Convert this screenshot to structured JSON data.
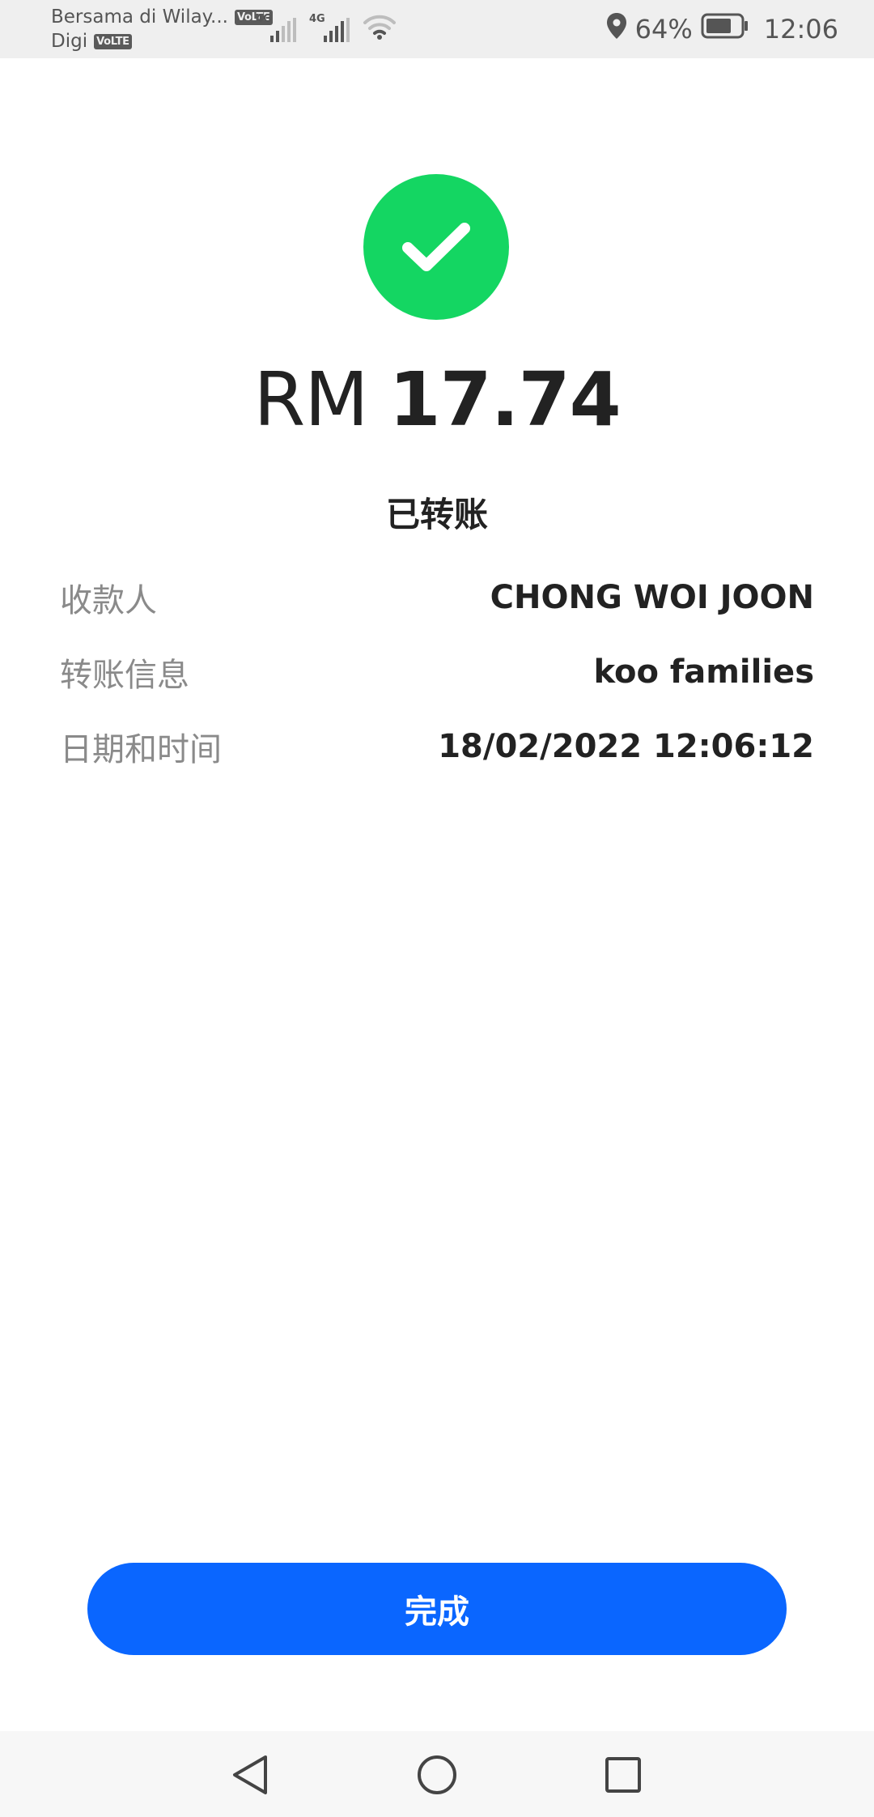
{
  "status_bar": {
    "carrier_1": "Bersama di Wilay...",
    "carrier_2": "Digi",
    "volte_badge": "VoLTE",
    "network_type": "4G",
    "battery_percent": "64%",
    "time": "12:06",
    "icons": [
      "signal-icon",
      "wifi-icon",
      "location-icon",
      "battery-icon"
    ]
  },
  "receipt": {
    "success_icon": "checkmark-icon",
    "success_color": "#14d662",
    "currency": "RM",
    "amount": "17.74",
    "status": "已转账",
    "details": [
      {
        "label": "收款人",
        "value": "CHONG WOI JOON"
      },
      {
        "label": "转账信息",
        "value": "koo families"
      },
      {
        "label": "日期和时间",
        "value": "18/02/2022 12:06:12"
      }
    ]
  },
  "actions": {
    "done_label": "完成",
    "done_color": "#0a66ff"
  },
  "nav_bar": {
    "icons": [
      "back-icon",
      "home-icon",
      "recents-icon"
    ]
  }
}
